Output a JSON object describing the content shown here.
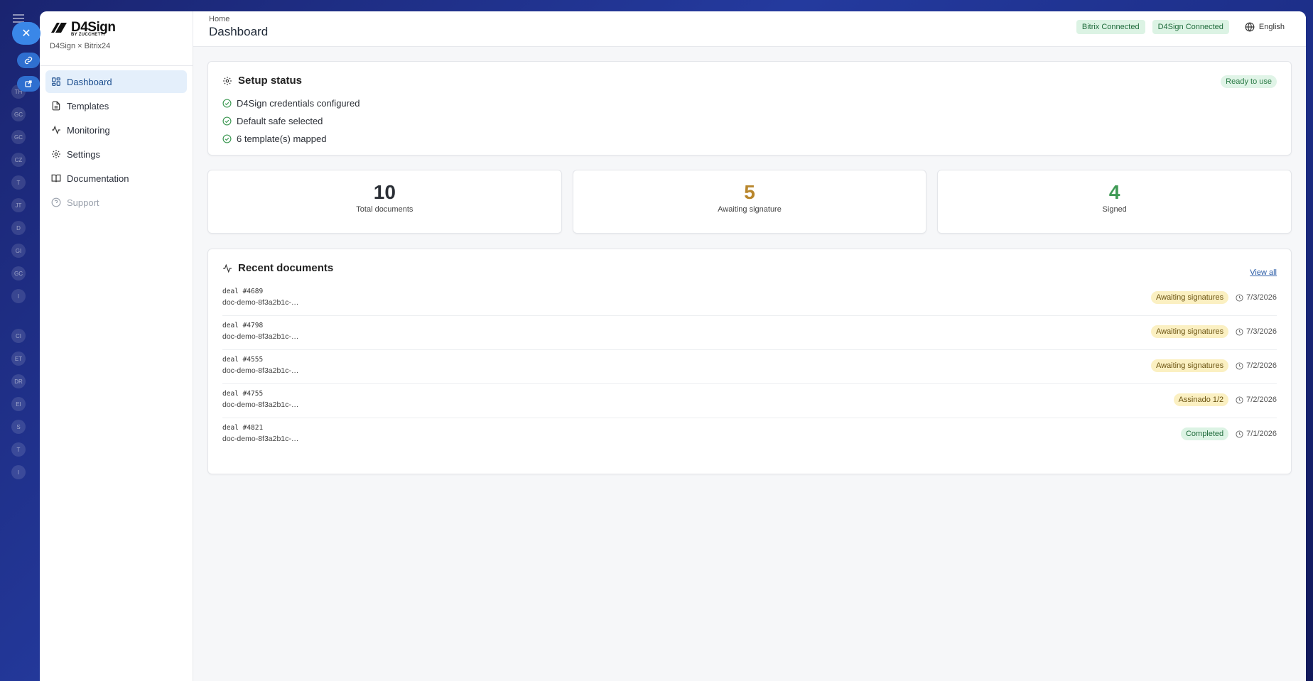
{
  "background": {
    "rail_items": [
      "TH",
      "GC",
      "GC",
      "CZ",
      "T",
      "JT",
      "D",
      "GI",
      "GC",
      "I",
      "CI",
      "ET",
      "DR",
      "EI",
      "S",
      "T",
      "I"
    ]
  },
  "brand": {
    "logo_text": "D4Sign",
    "logo_sub": "BY ZUCCHETTI",
    "caption": "D4Sign × Bitrix24"
  },
  "nav": {
    "items": [
      {
        "label": "Dashboard",
        "icon": "dashboard-icon",
        "active": true
      },
      {
        "label": "Templates",
        "icon": "document-icon"
      },
      {
        "label": "Monitoring",
        "icon": "activity-icon"
      },
      {
        "label": "Settings",
        "icon": "gear-icon"
      },
      {
        "label": "Documentation",
        "icon": "book-icon"
      },
      {
        "label": "Support",
        "icon": "help-icon",
        "disabled": true
      }
    ]
  },
  "header": {
    "breadcrumb": "Home",
    "title": "Dashboard",
    "bitrix_status": "Bitrix Connected",
    "d4sign_status": "D4Sign Connected",
    "language": "English"
  },
  "setup": {
    "title": "Setup status",
    "badge": "Ready to use",
    "checks": [
      "D4Sign credentials configured",
      "Default safe selected",
      "6 template(s) mapped"
    ]
  },
  "stats": [
    {
      "value": "10",
      "label": "Total documents",
      "color": "#2a2e35"
    },
    {
      "value": "5",
      "label": "Awaiting signature",
      "color": "#b8862c"
    },
    {
      "value": "4",
      "label": "Signed",
      "color": "#3f9a55"
    }
  ],
  "recent": {
    "title": "Recent documents",
    "view_all": "View all",
    "rows": [
      {
        "deal": "deal #4689",
        "doc": "doc-demo-8f3a2b1c-…",
        "status": "Awaiting signatures",
        "kind": "await",
        "date": "7/3/2026"
      },
      {
        "deal": "deal #4798",
        "doc": "doc-demo-8f3a2b1c-…",
        "status": "Awaiting signatures",
        "kind": "await",
        "date": "7/3/2026"
      },
      {
        "deal": "deal #4555",
        "doc": "doc-demo-8f3a2b1c-…",
        "status": "Awaiting signatures",
        "kind": "await",
        "date": "7/2/2026"
      },
      {
        "deal": "deal #4755",
        "doc": "doc-demo-8f3a2b1c-…",
        "status": "Assinado 1/2",
        "kind": "partial",
        "date": "7/2/2026"
      },
      {
        "deal": "deal #4821",
        "doc": "doc-demo-8f3a2b1c-…",
        "status": "Completed",
        "kind": "done",
        "date": "7/1/2026"
      }
    ]
  },
  "colors": {
    "accent": "#1d4f8f",
    "success": "#3f9a55",
    "warning": "#b8862c"
  }
}
